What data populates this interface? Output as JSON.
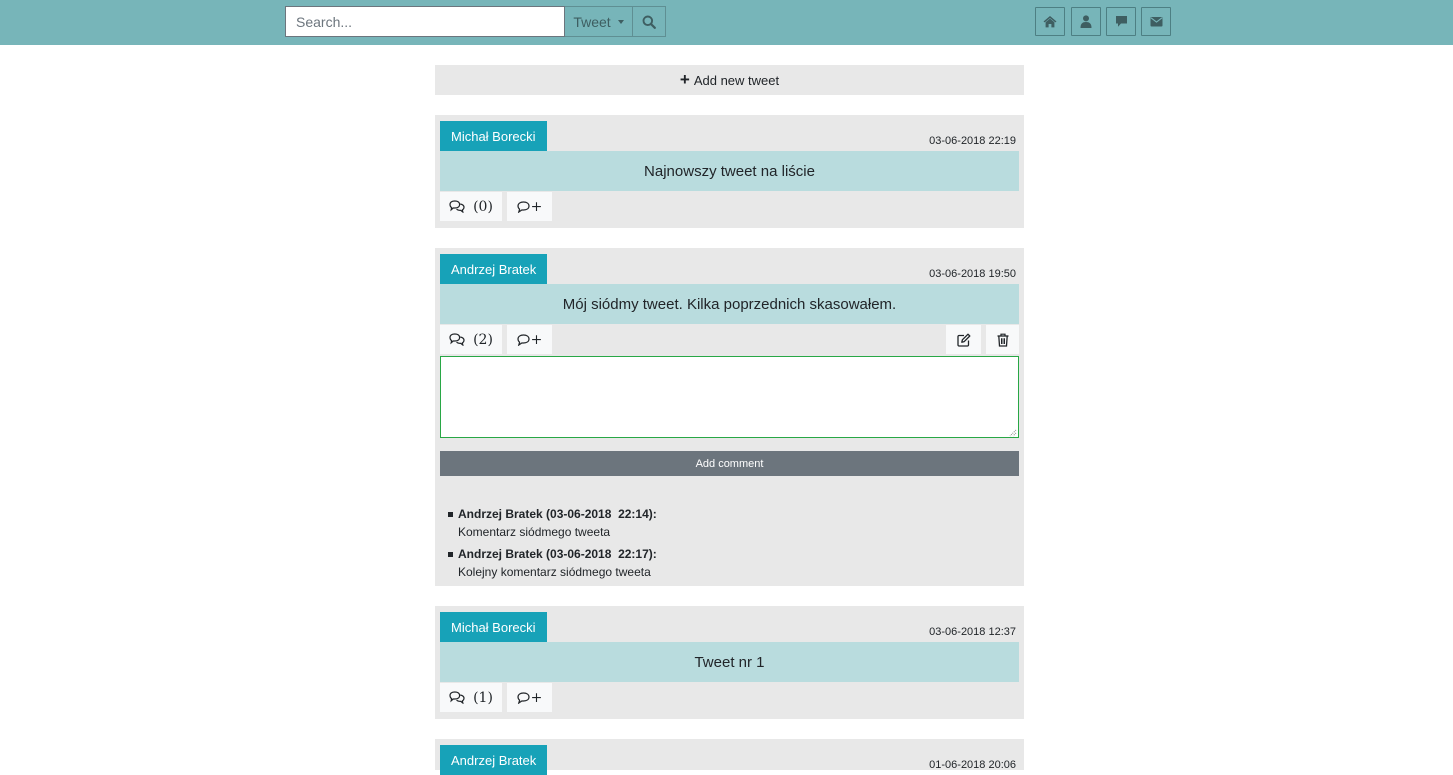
{
  "search": {
    "placeholder": "Search...",
    "value": ""
  },
  "filter": {
    "selected": "Tweet"
  },
  "nav": {
    "icons": [
      "home-icon",
      "user-icon",
      "chat-icon",
      "envelope-icon"
    ]
  },
  "feed": {
    "add_tweet_label": "Add new tweet",
    "tweets": [
      {
        "author": "Michał Borecki",
        "date": "03-06-2018 22:19",
        "text": "Najnowszy tweet na liście",
        "comment_count": "(0)",
        "add_comment_glyph": "+"
      },
      {
        "author": "Andrzej Bratek",
        "date": "03-06-2018 19:50",
        "text": "Mój siódmy tweet. Kilka poprzednich skasowałem.",
        "comment_count": "(2)",
        "add_comment_glyph": "+",
        "add_comment_label": "Add comment",
        "comments": [
          {
            "header": "Andrzej Bratek (03-06-2018  22:14):",
            "body": "Komentarz siódmego tweeta"
          },
          {
            "header": "Andrzej Bratek (03-06-2018  22:17):",
            "body": "Kolejny komentarz siódmego tweeta"
          }
        ]
      },
      {
        "author": "Michał Borecki",
        "date": "03-06-2018 12:37",
        "text": "Tweet nr 1",
        "comment_count": "(1)",
        "add_comment_glyph": "+"
      },
      {
        "author": "Andrzej Bratek",
        "date": "01-06-2018 20:06"
      }
    ]
  },
  "colors": {
    "topbar": "#77b5b9",
    "author_badge": "#17a2b8",
    "tweet_content": "#b9dcde",
    "card_bg": "#e8e8e8",
    "add_comment_button": "#6c757d",
    "textarea_border": "#28a745"
  }
}
